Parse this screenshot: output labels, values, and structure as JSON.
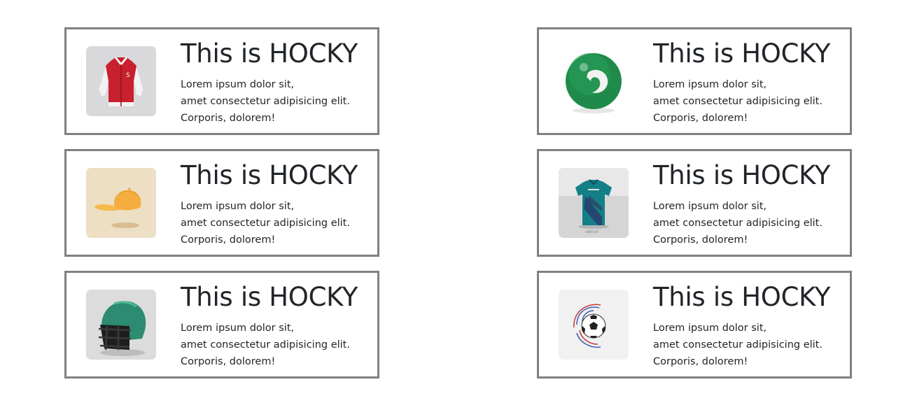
{
  "cards": [
    {
      "image_name": "varsity-jacket",
      "title": "This is HOCKY",
      "lines": [
        "Lorem ipsum dolor sit,",
        "amet consectetur adipisicing elit.",
        "Corporis, dolorem!"
      ]
    },
    {
      "image_name": "green-ball",
      "title": "This is HOCKY",
      "lines": [
        "Lorem ipsum dolor sit,",
        "amet consectetur adipisicing elit.",
        "Corporis, dolorem!"
      ]
    },
    {
      "image_name": "yellow-cap",
      "title": "This is HOCKY",
      "lines": [
        "Lorem ipsum dolor sit,",
        "amet consectetur adipisicing elit.",
        "Corporis, dolorem!"
      ]
    },
    {
      "image_name": "teal-jersey",
      "title": "This is HOCKY",
      "lines": [
        "Lorem ipsum dolor sit,",
        "amet consectetur adipisicing elit.",
        "Corporis, dolorem!"
      ]
    },
    {
      "image_name": "football-helmet",
      "title": "This is HOCKY",
      "lines": [
        "Lorem ipsum dolor sit,",
        "amet consectetur adipisicing elit.",
        "Corporis, dolorem!"
      ]
    },
    {
      "image_name": "soccer-ball",
      "title": "This is HOCKY",
      "lines": [
        "Lorem ipsum dolor sit,",
        "amet consectetur adipisicing elit.",
        "Corporis, dolorem!"
      ]
    }
  ],
  "colors": {
    "card_border": "#808080",
    "text": "#212529",
    "background": "#ffffff"
  }
}
